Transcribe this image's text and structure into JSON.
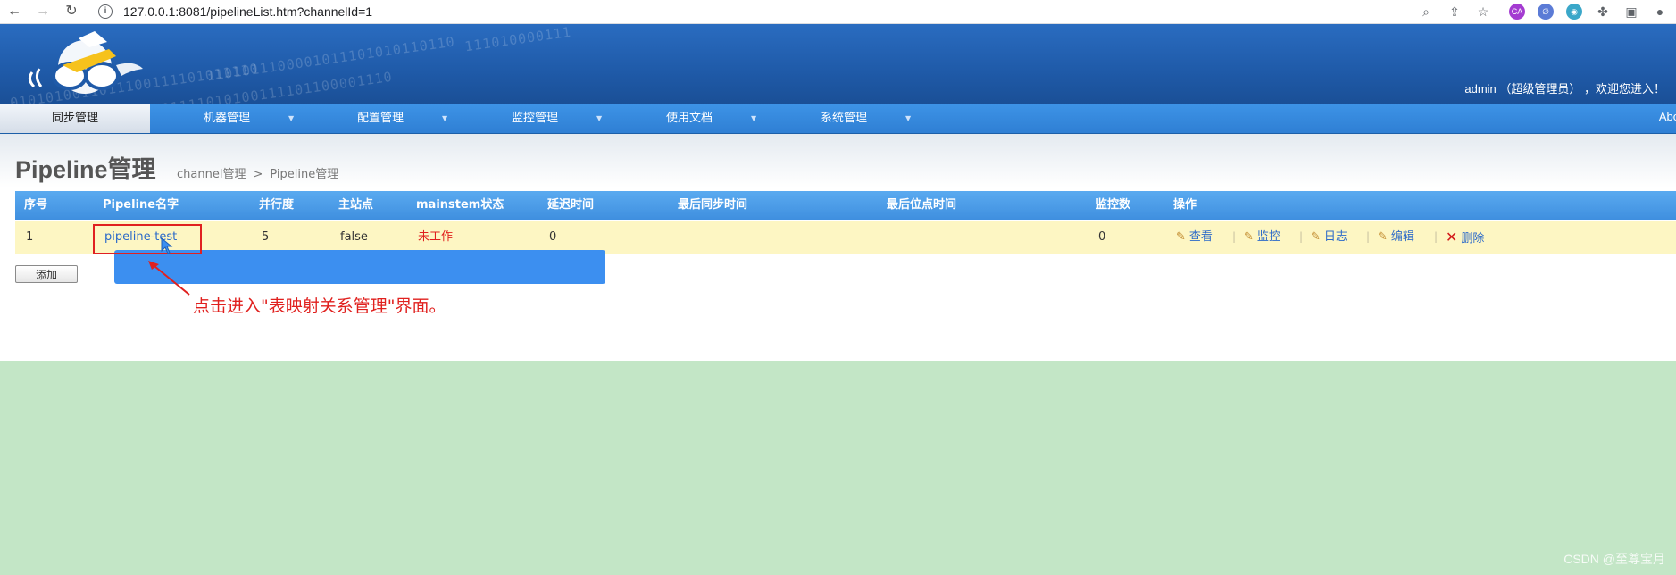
{
  "browser": {
    "url": "127.0.0.1:8081/pipelineList.htm?channelId=1",
    "ext_letters": [
      "CA"
    ]
  },
  "header": {
    "welcome": "admin （超级管理员） ，欢迎您进入！",
    "binary_rows": [
      "0101010011011100111101011110",
      "1101011100001011101010110110",
      "00001111010100111101100001110",
      "111010000111"
    ]
  },
  "menu": {
    "items": [
      {
        "label": "同步管理",
        "active": true
      },
      {
        "label": "机器管理"
      },
      {
        "label": "配置管理"
      },
      {
        "label": "监控管理"
      },
      {
        "label": "使用文档"
      },
      {
        "label": "系统管理"
      }
    ],
    "right_text": "Abo"
  },
  "page": {
    "title": "Pipeline管理",
    "breadcrumb": {
      "parent": "channel管理",
      "sep": ">",
      "current": "Pipeline管理"
    }
  },
  "table": {
    "columns": [
      "序号",
      "Pipeline名字",
      "并行度",
      "主站点",
      "mainstem状态",
      "延迟时间",
      "最后同步时间",
      "最后位点时间",
      "监控数",
      "操作"
    ],
    "rows": [
      {
        "index": "1",
        "name": "pipeline-test",
        "parallelism": "5",
        "main_site": "false",
        "mainstem_status": "未工作",
        "delay": "0",
        "last_sync": "",
        "last_position": "",
        "monitor_count": "0"
      }
    ],
    "actions": [
      "查看",
      "监控",
      "日志",
      "编辑",
      "删除"
    ],
    "action_sep": "|"
  },
  "add_button": "添加",
  "annotation": "点击进入\"表映射关系管理\"界面。",
  "watermark": "CSDN @至尊宝月",
  "colors": {
    "header": "#2a6cc0",
    "menu": "#3d93e6",
    "row": "#fdf6c3",
    "annotation": "#e0201e",
    "background": "#c3e6c6"
  }
}
